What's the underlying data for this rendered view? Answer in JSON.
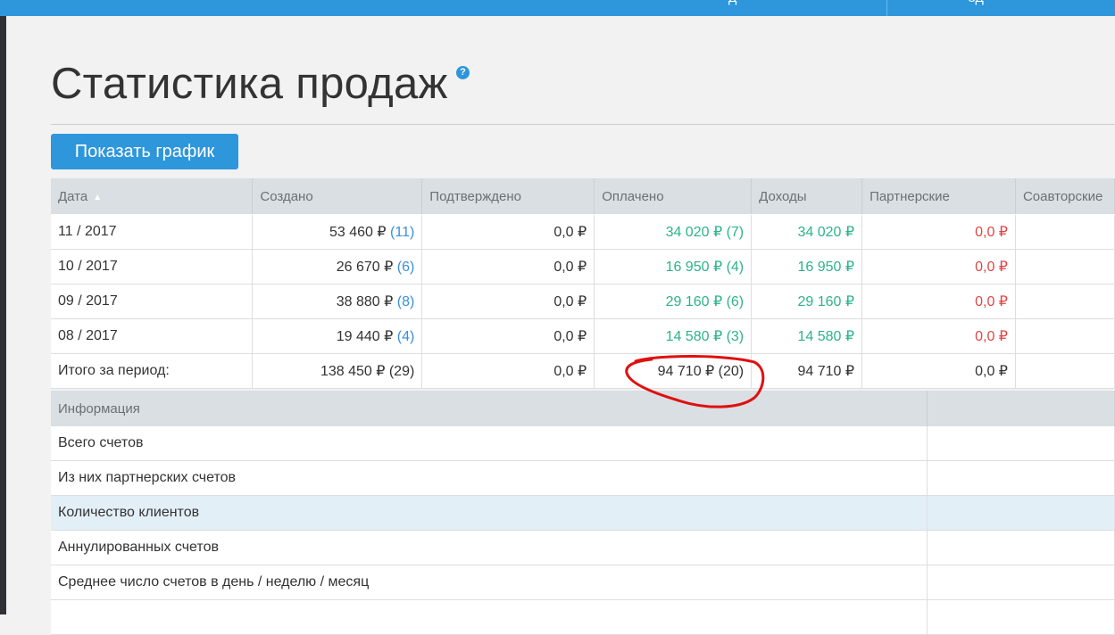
{
  "page": {
    "title": "Статистика продаж",
    "help_icon": "?"
  },
  "toolbar": {
    "show_chart_label": "Показать график"
  },
  "topbar": {
    "peek_left": "д",
    "peek_right": "ед"
  },
  "stats_table": {
    "headers": [
      "Дата",
      "Создано",
      "Подтверждено",
      "Оплачено",
      "Доходы",
      "Партнерские",
      "Соавторские"
    ],
    "rows": [
      {
        "date": "11 / 2017",
        "created_sum": "53 460 ₽",
        "created_count": "(11)",
        "confirmed": "0,0 ₽",
        "paid": "34 020 ₽ (7)",
        "income": "34 020 ₽",
        "partner": "0,0 ₽",
        "coauthor": ""
      },
      {
        "date": "10 / 2017",
        "created_sum": "26 670 ₽",
        "created_count": "(6)",
        "confirmed": "0,0 ₽",
        "paid": "16 950 ₽ (4)",
        "income": "16 950 ₽",
        "partner": "0,0 ₽",
        "coauthor": ""
      },
      {
        "date": "09 / 2017",
        "created_sum": "38 880 ₽",
        "created_count": "(8)",
        "confirmed": "0,0 ₽",
        "paid": "29 160 ₽ (6)",
        "income": "29 160 ₽",
        "partner": "0,0 ₽",
        "coauthor": ""
      },
      {
        "date": "08 / 2017",
        "created_sum": "19 440 ₽",
        "created_count": "(4)",
        "confirmed": "0,0 ₽",
        "paid": "14 580 ₽ (3)",
        "income": "14 580 ₽",
        "partner": "0,0 ₽",
        "coauthor": ""
      }
    ],
    "total": {
      "label": "Итого за период:",
      "created": "138 450 ₽ (29)",
      "confirmed": "0,0 ₽",
      "paid": "94 710 ₽ (20)",
      "income": "94 710 ₽",
      "partner": "0,0 ₽",
      "coauthor": ""
    }
  },
  "info_table": {
    "header": "Информация",
    "rows": [
      {
        "label": "Всего счетов",
        "value": ""
      },
      {
        "label": "Из них партнерских счетов",
        "value": ""
      },
      {
        "label": "Количество клиентов",
        "value": ""
      },
      {
        "label": "Аннулированных счетов",
        "value": ""
      },
      {
        "label": "Среднее число счетов в день / неделю / месяц",
        "value": ""
      },
      {
        "label": "",
        "value": ""
      }
    ]
  },
  "colors": {
    "accent": "#2e96db",
    "positive": "#2db38a",
    "negative": "#e04646",
    "count": "#3a8fd8",
    "annotation": "#e01010"
  },
  "icons": {
    "sort": "sort-asc-icon",
    "help": "help-icon"
  }
}
